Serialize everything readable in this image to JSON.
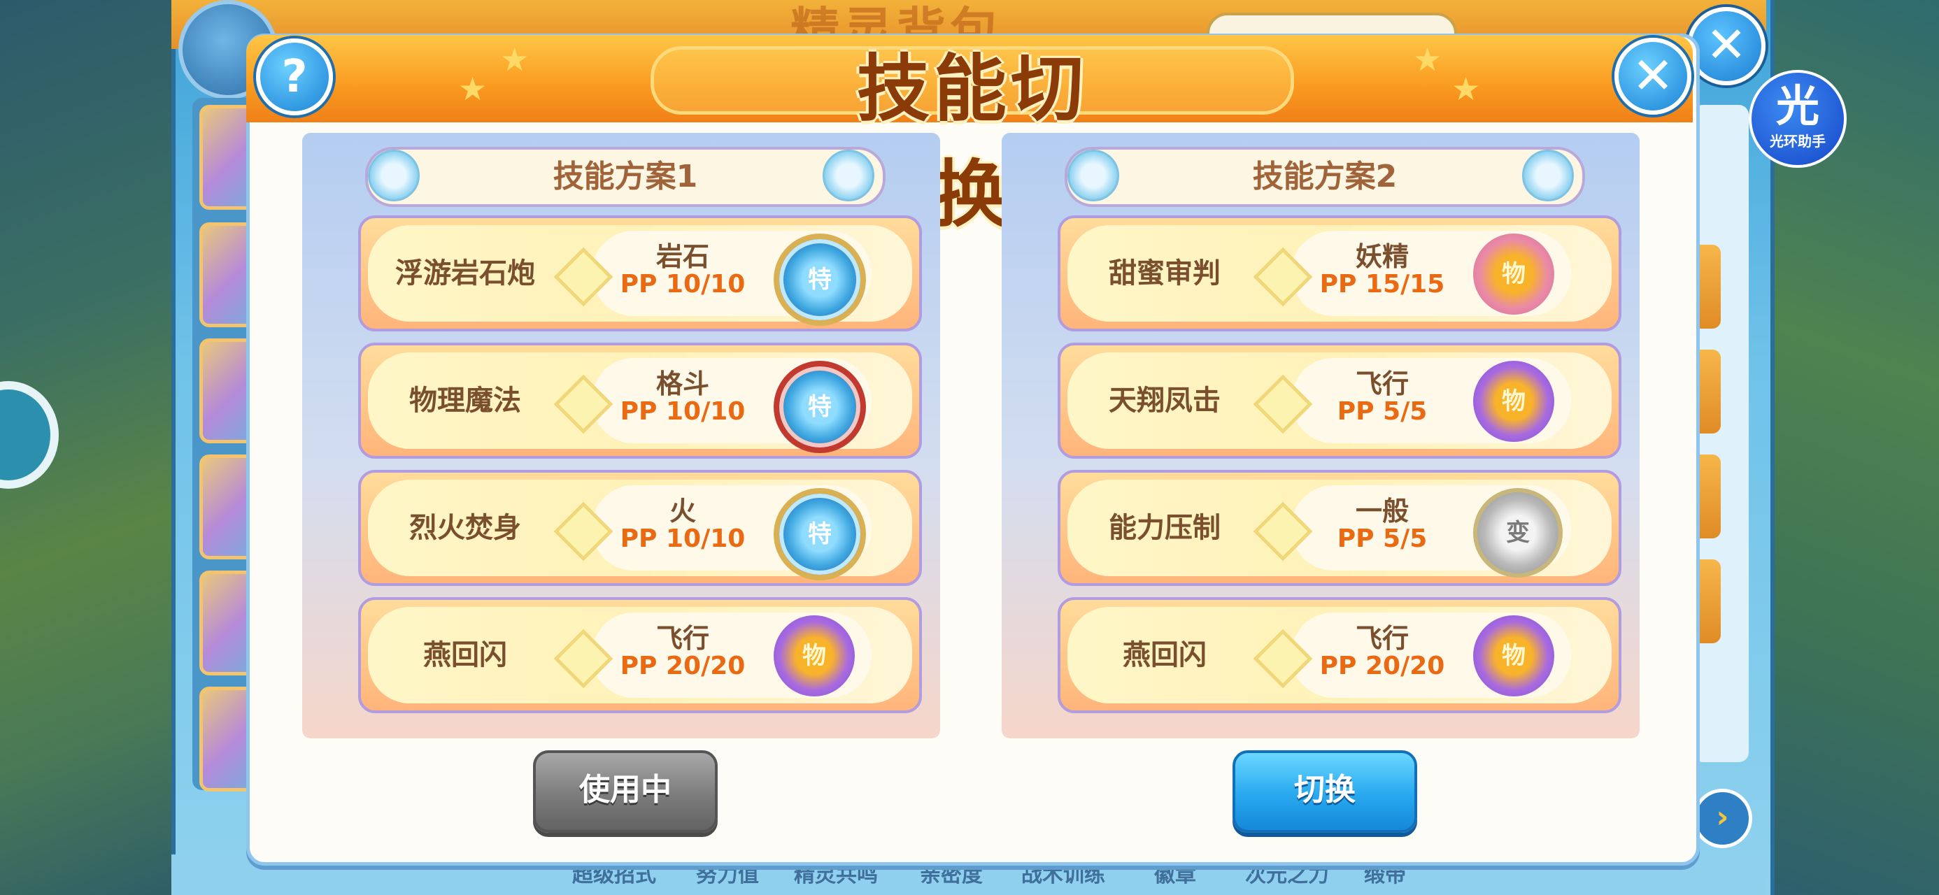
{
  "background": {
    "title": "精灵背包",
    "bottom_tabs": [
      "超级招式",
      "努力值",
      "精灵共鸣",
      "亲密度",
      "战术训练",
      "徽章",
      "次元之力",
      "缎带"
    ]
  },
  "helper": {
    "glyph": "光",
    "label": "光环助手"
  },
  "dialog": {
    "title": "技能切换",
    "help_label": "?",
    "close_label": "✕"
  },
  "plans": [
    {
      "label": "技能方案1",
      "skills": [
        {
          "name": "浮游岩石炮",
          "type": "岩石",
          "pp": "PP 10/10",
          "category": "特"
        },
        {
          "name": "物理魔法",
          "type": "格斗",
          "pp": "PP 10/10",
          "category": "特"
        },
        {
          "name": "烈火焚身",
          "type": "火",
          "pp": "PP 10/10",
          "category": "特"
        },
        {
          "name": "燕回闪",
          "type": "飞行",
          "pp": "PP 20/20",
          "category": "物"
        }
      ],
      "button": "使用中"
    },
    {
      "label": "技能方案2",
      "skills": [
        {
          "name": "甜蜜审判",
          "type": "妖精",
          "pp": "PP 15/15",
          "category": "物"
        },
        {
          "name": "天翔凤击",
          "type": "飞行",
          "pp": "PP 5/5",
          "category": "物"
        },
        {
          "name": "能力压制",
          "type": "一般",
          "pp": "PP 5/5",
          "category": "变"
        },
        {
          "name": "燕回闪",
          "type": "飞行",
          "pp": "PP 20/20",
          "category": "物"
        }
      ],
      "button": "切换"
    }
  ]
}
